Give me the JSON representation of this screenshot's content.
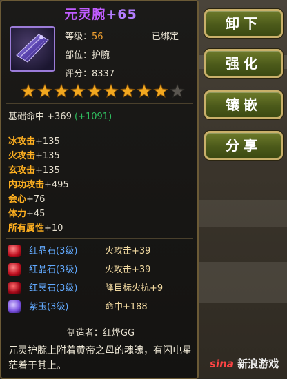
{
  "item": {
    "name": "元灵腕",
    "enhance": "+65",
    "level_label": "等级：",
    "level_value": "56",
    "bound": "已绑定",
    "slot_label": "部位：",
    "slot_value": "护腕",
    "score_label": "评分：",
    "score_value": "8337",
    "stars_filled": 9,
    "stars_total": 10
  },
  "base_stat": {
    "label": "基础命中",
    "value": "+369",
    "bonus": "(+1091)"
  },
  "attributes": [
    {
      "name": "冰攻击",
      "value": "+135"
    },
    {
      "name": "火攻击",
      "value": "+135"
    },
    {
      "name": "玄攻击",
      "value": "+135"
    },
    {
      "name": "内功攻击",
      "value": "+495"
    },
    {
      "name": "会心",
      "value": "+76"
    },
    {
      "name": "体力",
      "value": "+45"
    },
    {
      "name": "所有属性",
      "value": "+10"
    }
  ],
  "gems": [
    {
      "name": "红晶石",
      "level": "(3级)",
      "effect": "火攻击+39",
      "color": "#d02030"
    },
    {
      "name": "红晶石",
      "level": "(3级)",
      "effect": "火攻击+39",
      "color": "#d02030"
    },
    {
      "name": "红冥石",
      "level": "(3级)",
      "effect": "降目标火抗+9",
      "color": "#c01818"
    },
    {
      "name": "紫玉",
      "level": "(3级)",
      "effect": "命中+188",
      "color": "#8a5cff"
    }
  ],
  "maker": "制造者：红烨GG",
  "description": "元灵护腕上附着黄帝之母的魂魄，有闪电星茫着于其上。",
  "buttons": {
    "unequip": "卸下",
    "enhance": "强化",
    "inlay": "镶嵌",
    "share": "分享"
  },
  "watermark": {
    "brand": "sina",
    "text": "新浪游戏"
  },
  "colors": {
    "title_purple": "#c05cff",
    "gold_text": "#ffb020",
    "green_bonus": "#30c060",
    "gem_blue": "#62aaff",
    "button_green": "#5a6a1e",
    "button_border": "#c9b06a"
  }
}
